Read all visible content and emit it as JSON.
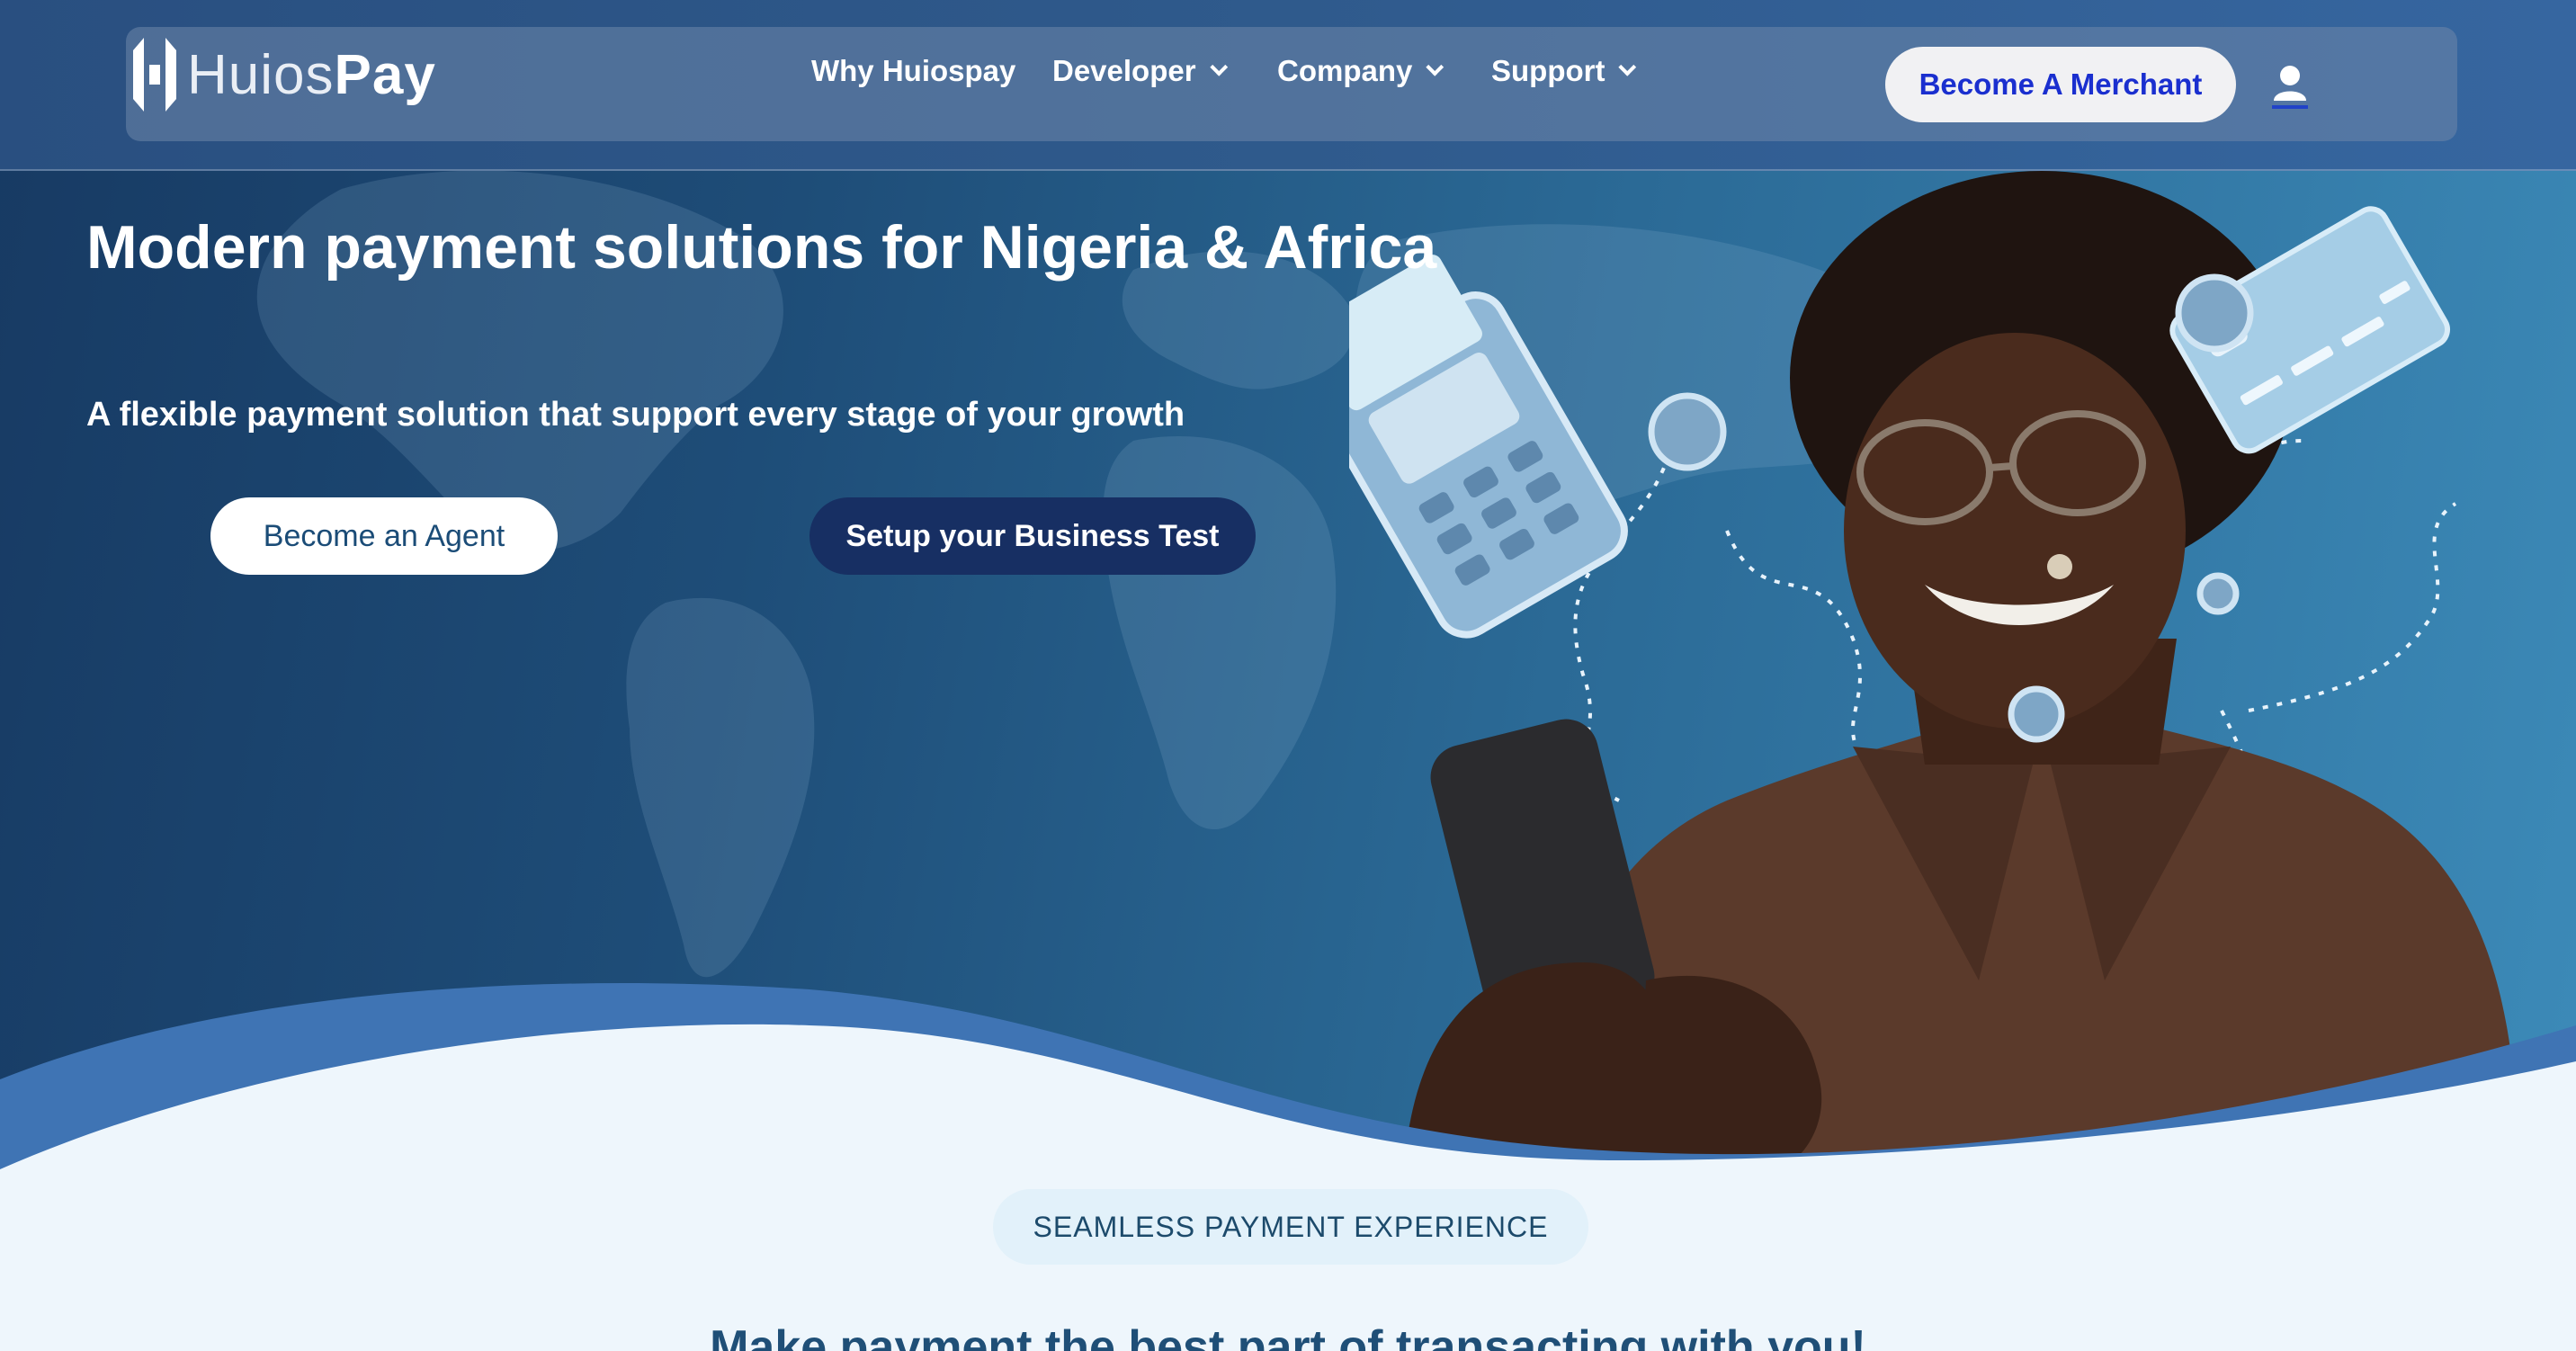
{
  "header": {
    "logo_prefix": "Huios",
    "logo_suffix": "Pay",
    "nav": [
      {
        "label": "Why Huiospay",
        "has_dropdown": false
      },
      {
        "label": "Developer",
        "has_dropdown": true
      },
      {
        "label": "Company",
        "has_dropdown": true
      },
      {
        "label": "Support",
        "has_dropdown": true
      }
    ],
    "merchant_label": "Become A Merchant",
    "user_icon": "user-icon"
  },
  "hero": {
    "title": "Modern payment solutions for Nigeria & Africa",
    "subtitle": "A flexible payment solution that support every stage of your growth",
    "agent_label": "Become an Agent",
    "business_label": "Setup your Business Test"
  },
  "section": {
    "badge": "SEAMLESS PAYMENT EXPERIENCE",
    "heading": "Make payment the best part of transacting with you!"
  },
  "colors": {
    "hero_dark": "#173a63",
    "hero_light": "#3c8ab8",
    "merchant_text": "#1a2fcf",
    "business_button": "#172f63",
    "wave_blue": "#3f74b4",
    "page_background": "#eef6fc"
  }
}
